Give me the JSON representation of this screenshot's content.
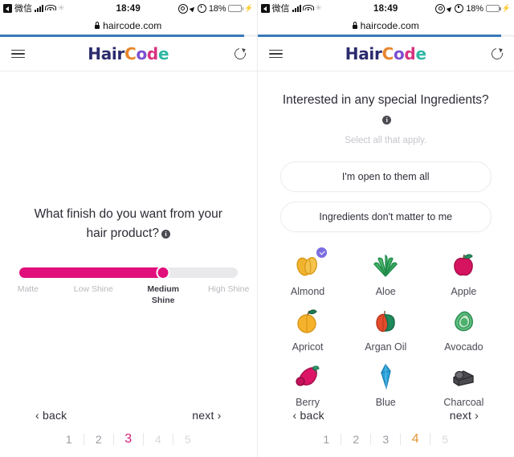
{
  "status_bar": {
    "back_app": "微信",
    "time": "18:49",
    "battery_percent": "18%",
    "battery_fill_pct": 18,
    "icons": [
      "back-icon",
      "signal-bars-icon",
      "wifi-icon",
      "do-not-disturb-icon",
      "rotation-lock-icon",
      "location-arrow-icon",
      "alarm-clock-icon",
      "battery-icon",
      "charging-bolt-icon"
    ]
  },
  "browser": {
    "url": "haircode.com",
    "lock_icon": "lock-icon",
    "progress_pct": 95,
    "progress_color": "#3878b8"
  },
  "app_header": {
    "menu_icon": "hamburger-menu-icon",
    "refresh_icon": "refresh-icon",
    "logo": {
      "parts": [
        {
          "text": "Hair",
          "color": "#2b2b6e"
        },
        {
          "text": "C",
          "color": "#e8852c"
        },
        {
          "text": "o",
          "color": "#7b4fd0"
        },
        {
          "text": "d",
          "color": "#d9337f"
        },
        {
          "text": "e",
          "color": "#2eb7a4"
        }
      ]
    }
  },
  "left_panel": {
    "question": "What finish do you want from your hair product?",
    "info_icon": "info-icon",
    "slider": {
      "fill_pct": 66,
      "fill_color": "#e00f7c",
      "track_color": "#e9e9ec",
      "selected_value": "Medium Shine",
      "options": [
        {
          "label": "Matte",
          "pos_pct": 2,
          "active": false
        },
        {
          "label": "Low Shine",
          "pos_pct": 33,
          "active": false
        },
        {
          "label": "Medium Shine",
          "pos_pct": 66,
          "active": true
        },
        {
          "label": "High Shine",
          "pos_pct": 98,
          "active": false
        }
      ]
    },
    "nav": {
      "back_label": "back",
      "next_label": "next",
      "back_chevron": "‹",
      "next_chevron": "›",
      "current_page": 3,
      "accent": "#d81b74",
      "pages": [
        {
          "num": "1",
          "state": "visited"
        },
        {
          "num": "2",
          "state": "visited"
        },
        {
          "num": "3",
          "state": "current"
        },
        {
          "num": "4",
          "state": "future"
        },
        {
          "num": "5",
          "state": "future"
        }
      ]
    }
  },
  "right_panel": {
    "question": "Interested in any special Ingredients?",
    "info_icon": "info-icon",
    "subtitle": "Select all that apply.",
    "options": [
      {
        "label": "I'm open to them all"
      },
      {
        "label": "Ingredients don't matter to me"
      }
    ],
    "ingredients": [
      {
        "label": "Almond",
        "icon": "almond-icon",
        "selected": true
      },
      {
        "label": "Aloe",
        "icon": "aloe-icon",
        "selected": false
      },
      {
        "label": "Apple",
        "icon": "apple-icon",
        "selected": false
      },
      {
        "label": "Apricot",
        "icon": "apricot-icon",
        "selected": false
      },
      {
        "label": "Argan Oil",
        "icon": "argan-oil-icon",
        "selected": false
      },
      {
        "label": "Avocado",
        "icon": "avocado-icon",
        "selected": false
      },
      {
        "label": "Berry",
        "icon": "berry-icon",
        "selected": false
      },
      {
        "label": "Blue",
        "icon": "blue-icon",
        "selected": false
      },
      {
        "label": "Charcoal",
        "icon": "charcoal-icon",
        "selected": false
      }
    ],
    "nav": {
      "back_label": "back",
      "next_label": "next",
      "back_chevron": "‹",
      "next_chevron": "›",
      "current_page": 4,
      "accent": "#e59436",
      "pages": [
        {
          "num": "1",
          "state": "visited"
        },
        {
          "num": "2",
          "state": "visited"
        },
        {
          "num": "3",
          "state": "visited"
        },
        {
          "num": "4",
          "state": "current"
        },
        {
          "num": "5",
          "state": "future"
        }
      ]
    }
  }
}
